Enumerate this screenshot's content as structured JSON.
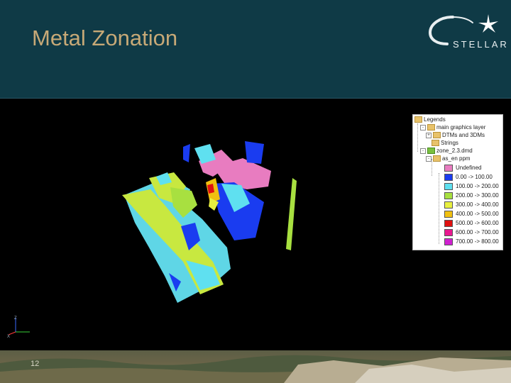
{
  "slide": {
    "title": "Metal Zonation",
    "page_number": "12"
  },
  "logo": {
    "text": "STELLAR",
    "icon": "star-burst-icon",
    "color": "#ffffff"
  },
  "axes": {
    "labels": [
      "Z",
      "X"
    ]
  },
  "legend": {
    "root": "Legends",
    "items": [
      {
        "label": "main graphics layer",
        "icon": "folder-icon"
      },
      {
        "label": "DTMs and 3DMs",
        "icon": "folder-icon"
      },
      {
        "label": "Strings",
        "icon": "folder-icon"
      },
      {
        "label": "zone_2.3.dmd",
        "icon": "folder-icon"
      },
      {
        "label": "as_en ppm",
        "icon": "folder-icon"
      }
    ],
    "ranges": [
      {
        "label": "Undefined",
        "color": "#e87cc0"
      },
      {
        "label": "0.00 -> 100.00",
        "color": "#1a3cf0"
      },
      {
        "label": "100.00 -> 200.00",
        "color": "#5fe0f0"
      },
      {
        "label": "200.00 -> 300.00",
        "color": "#a8e040"
      },
      {
        "label": "300.00 -> 400.00",
        "color": "#e8f040"
      },
      {
        "label": "400.00 -> 500.00",
        "color": "#f0c010"
      },
      {
        "label": "500.00 -> 600.00",
        "color": "#e01010"
      },
      {
        "label": "600.00 -> 700.00",
        "color": "#e81890"
      },
      {
        "label": "700.00 -> 800.00",
        "color": "#d020d0"
      }
    ]
  }
}
